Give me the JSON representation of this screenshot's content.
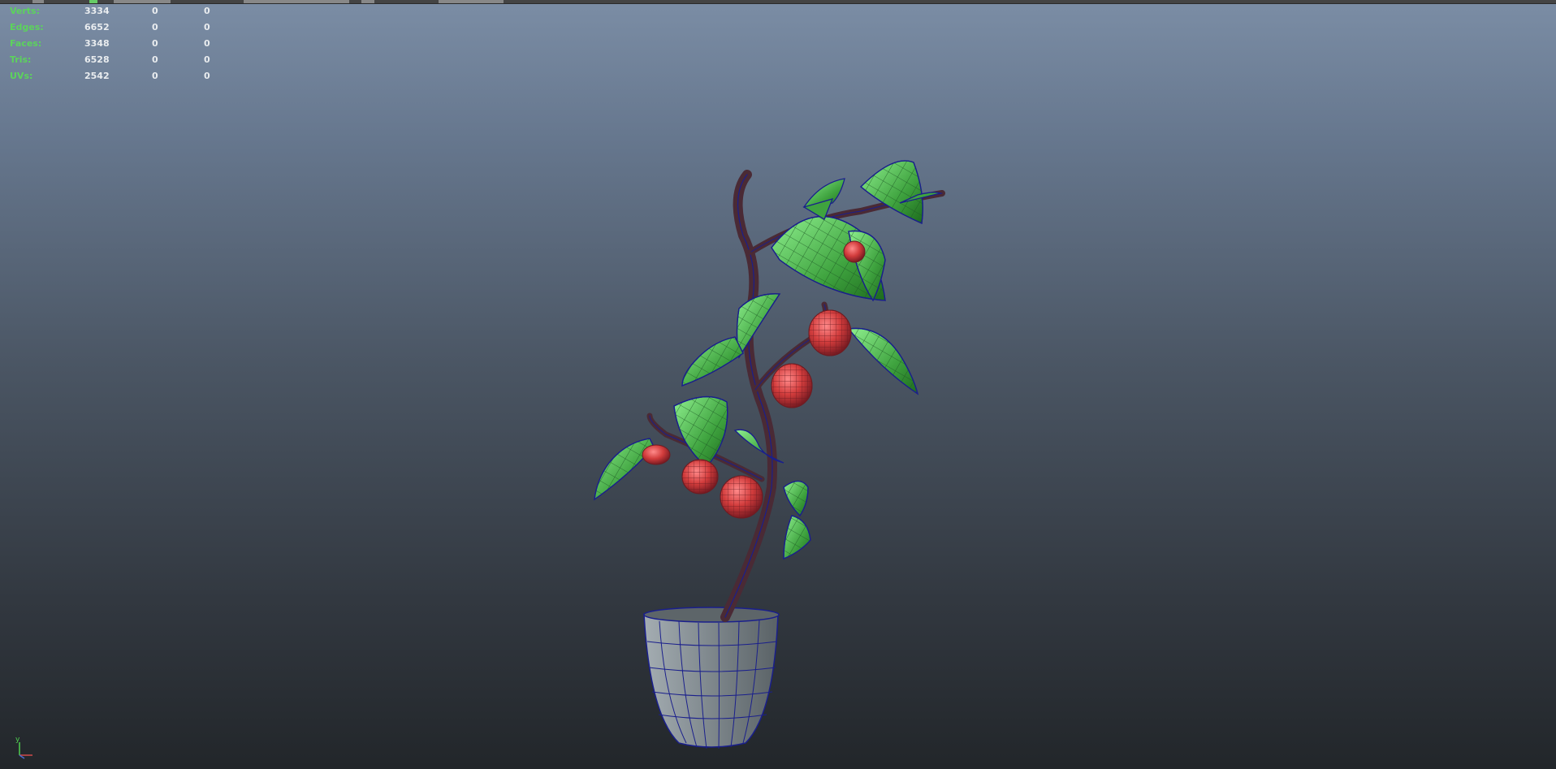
{
  "hud": {
    "rows": [
      {
        "label": "Verts:",
        "v1": "3334",
        "v2": "0",
        "v3": "0"
      },
      {
        "label": "Edges:",
        "v1": "6652",
        "v2": "0",
        "v3": "0"
      },
      {
        "label": "Faces:",
        "v1": "3348",
        "v2": "0",
        "v3": "0"
      },
      {
        "label": "Tris:",
        "v1": "6528",
        "v2": "0",
        "v3": "0"
      },
      {
        "label": "UVs:",
        "v1": "2542",
        "v2": "0",
        "v3": "0"
      }
    ]
  },
  "axis": {
    "y_label": "y"
  },
  "colors": {
    "hud_label": "#5cd35c",
    "hud_value": "#e9ecef",
    "leaf": "#3fa33f",
    "leaf_light": "#7be07b",
    "wire": "#1a1f8c",
    "fruit": "#c23a3a",
    "stem": "#4a2a35",
    "pot": "#8a9398"
  },
  "icons": [
    "toolbar-strip",
    "view-axis-icon"
  ]
}
